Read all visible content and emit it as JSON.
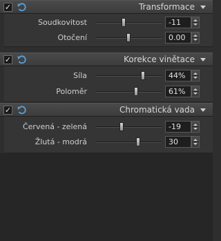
{
  "sections": [
    {
      "title": "Transformace",
      "checked": true,
      "rows": [
        {
          "label": "Soudkovitost",
          "value": "-11",
          "level": 0.43
        },
        {
          "label": "Otočení",
          "value": "0.00",
          "level": 0.5
        }
      ]
    },
    {
      "title": "Korekce vinětace",
      "checked": true,
      "rows": [
        {
          "label": "Síla",
          "value": "44%",
          "level": 0.72
        },
        {
          "label": "Poloměr",
          "value": "61%",
          "level": 0.61
        }
      ]
    },
    {
      "title": "Chromatická vada",
      "checked": true,
      "rows": [
        {
          "label": "Červená - zelená",
          "value": "-19",
          "level": 0.4
        },
        {
          "label": "Žlutá - modrá",
          "value": "30",
          "level": 0.65
        }
      ]
    }
  ],
  "icons": {
    "check": "checkbox-checked-icon",
    "reset": "reset-undo-icon",
    "collapse": "chevron-down-icon"
  }
}
